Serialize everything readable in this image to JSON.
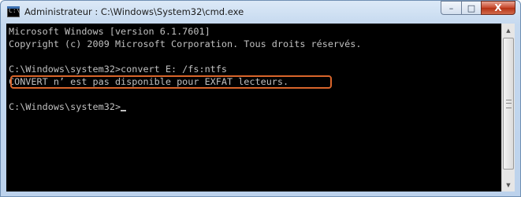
{
  "window": {
    "title": "Administrateur : C:\\Windows\\System32\\cmd.exe",
    "icon": "cmd-icon",
    "buttons": {
      "minimize": "–",
      "maximize": "□",
      "close": "X"
    }
  },
  "console": {
    "lines": [
      "Microsoft Windows [version 6.1.7601]",
      "Copyright (c) 2009 Microsoft Corporation. Tous droits réservés.",
      "",
      "C:\\Windows\\system32>convert E: /fs:ntfs",
      "CONVERT n’ est pas disponible pour EXFAT lecteurs.",
      "",
      "C:\\Windows\\system32>"
    ],
    "highlight_color": "#d9652b"
  },
  "colors": {
    "console_bg": "#000000",
    "console_text": "#c0c0c0",
    "close_button": "#c7462c"
  }
}
